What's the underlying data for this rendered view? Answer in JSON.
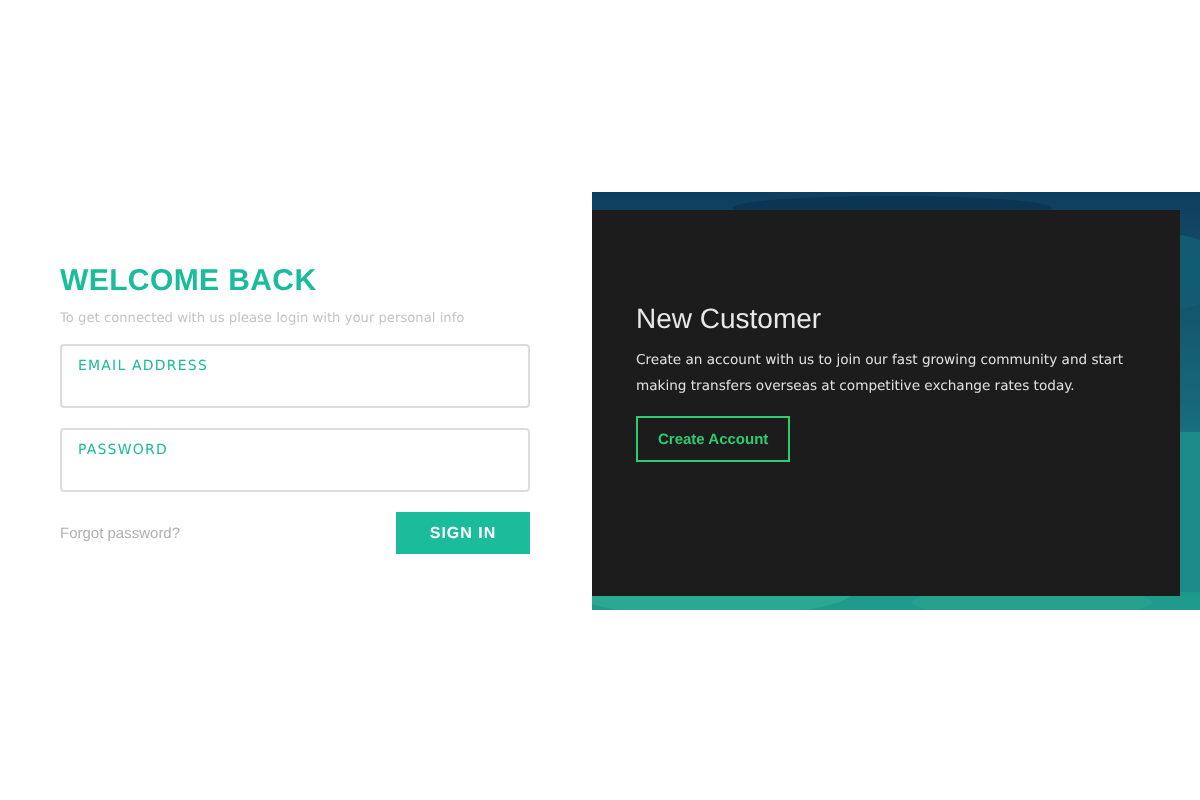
{
  "login": {
    "title": "WELCOME BACK",
    "subtitle": "To get connected with us please login with your personal info",
    "fields": [
      {
        "label": "EMAIL ADDRESS"
      },
      {
        "label": "PASSWORD"
      }
    ],
    "forgot_link": "Forgot password?",
    "submit_button": "SIGN IN"
  },
  "signup": {
    "title": "New Customer",
    "text": "Create an account with us to join our fast growing community and start making transfers overseas at competitive exchange rates today.",
    "button": "Create Account"
  }
}
